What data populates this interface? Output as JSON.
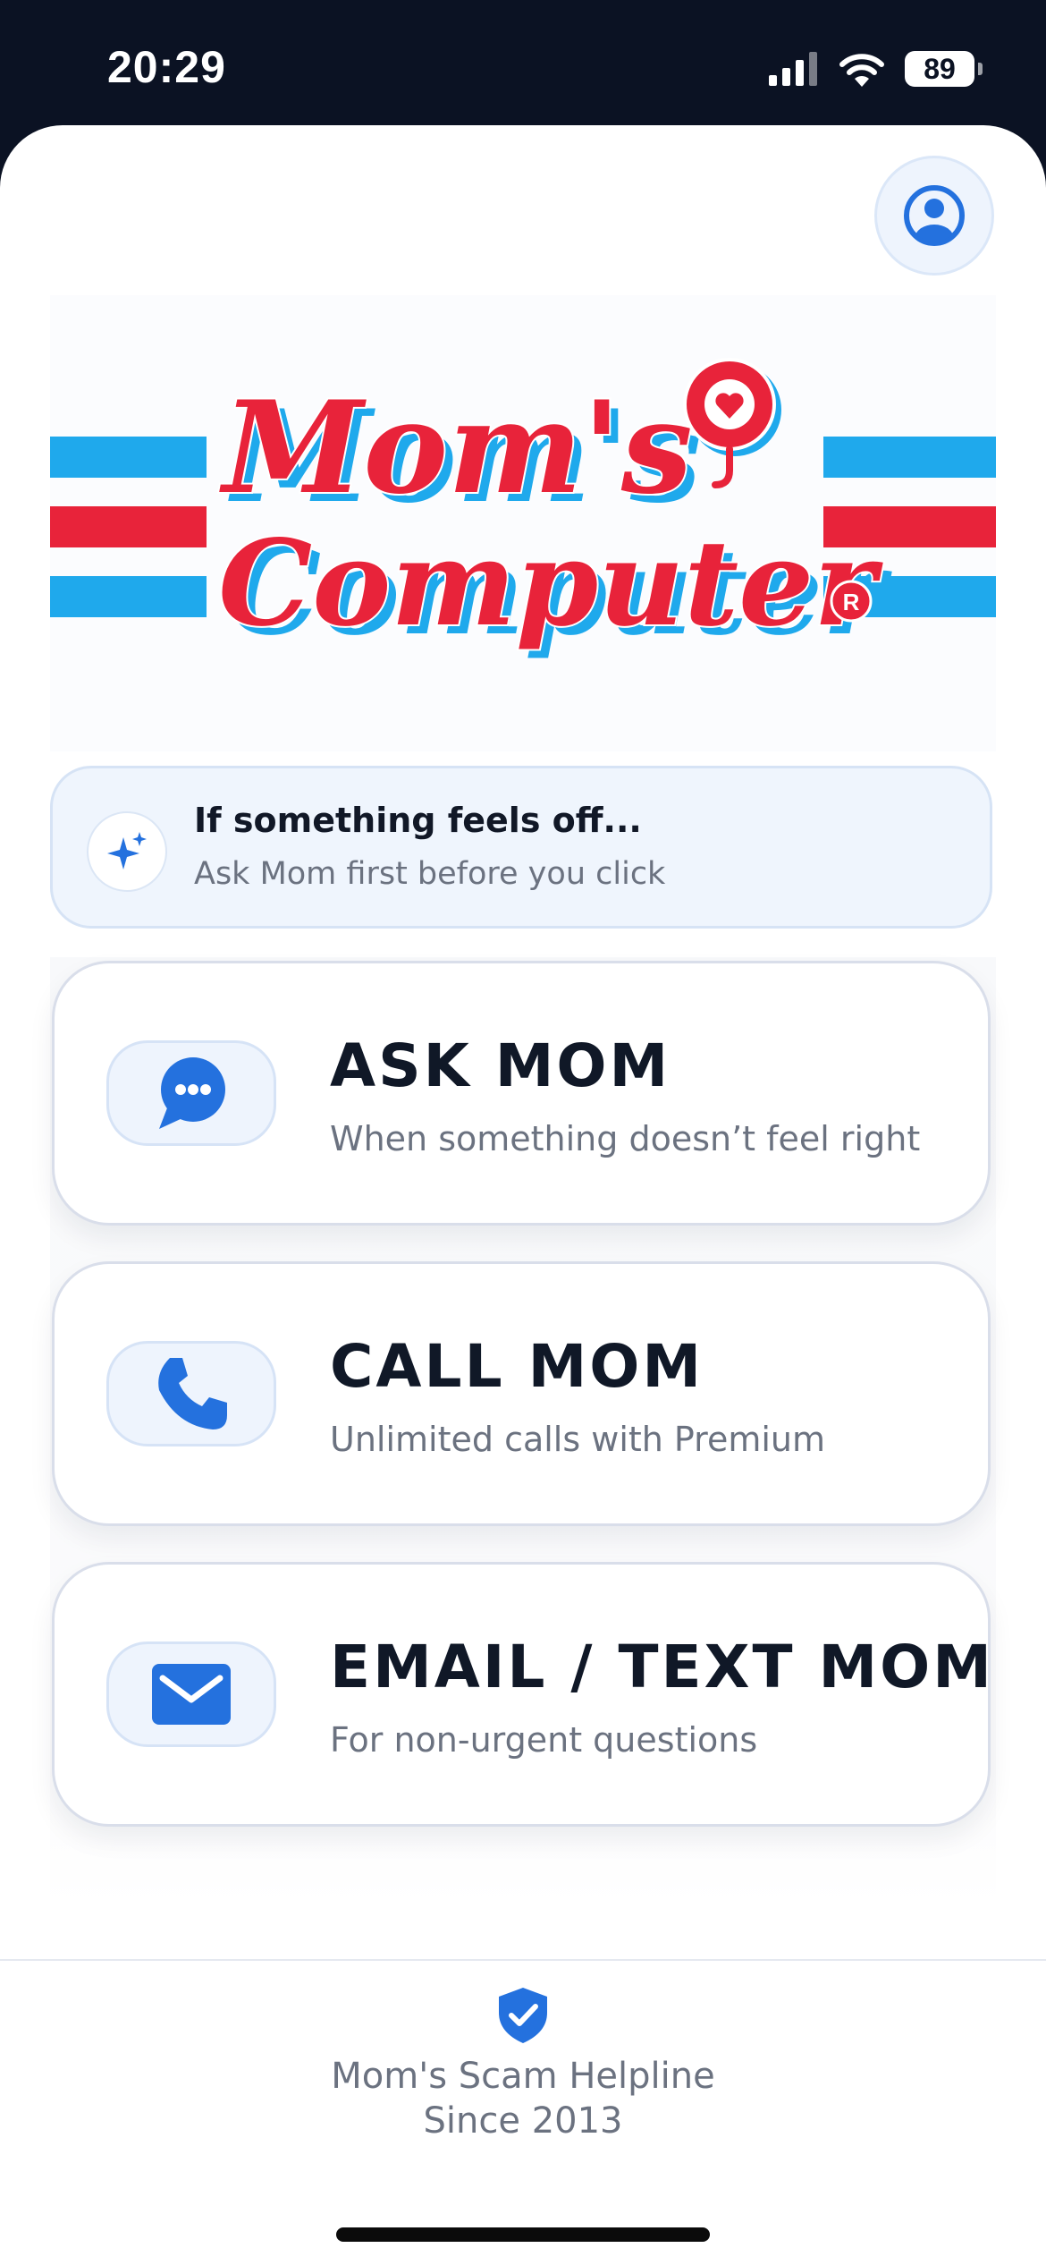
{
  "status_bar": {
    "time": "20:29",
    "battery_level": "89",
    "icons": [
      "signal-icon",
      "wifi-icon",
      "battery-icon"
    ]
  },
  "header": {
    "profile_icon": "user-circle-icon"
  },
  "logo": {
    "line1": "Mom's",
    "line2": "Computer",
    "registered_mark": "R",
    "colors": {
      "red": "#e8233a",
      "blue": "#1fa9ec"
    }
  },
  "tip": {
    "icon": "sparkles-icon",
    "title": "If something feels off...",
    "subtitle": "Ask Mom first before you click"
  },
  "actions": [
    {
      "icon": "chat-bubble-icon",
      "title": "ASK MOM",
      "subtitle": "When something doesn’t feel right"
    },
    {
      "icon": "phone-icon",
      "title": "CALL MOM",
      "subtitle": "Unlimited calls with Premium"
    },
    {
      "icon": "envelope-icon",
      "title": "EMAIL / TEXT MOM",
      "subtitle": "For non-urgent questions"
    }
  ],
  "footer": {
    "icon": "shield-check-icon",
    "line1": "Mom's Scam Helpline",
    "line2": "Since 2013"
  },
  "theme": {
    "accent": "#2471de",
    "background_dark": "#0b1223"
  }
}
